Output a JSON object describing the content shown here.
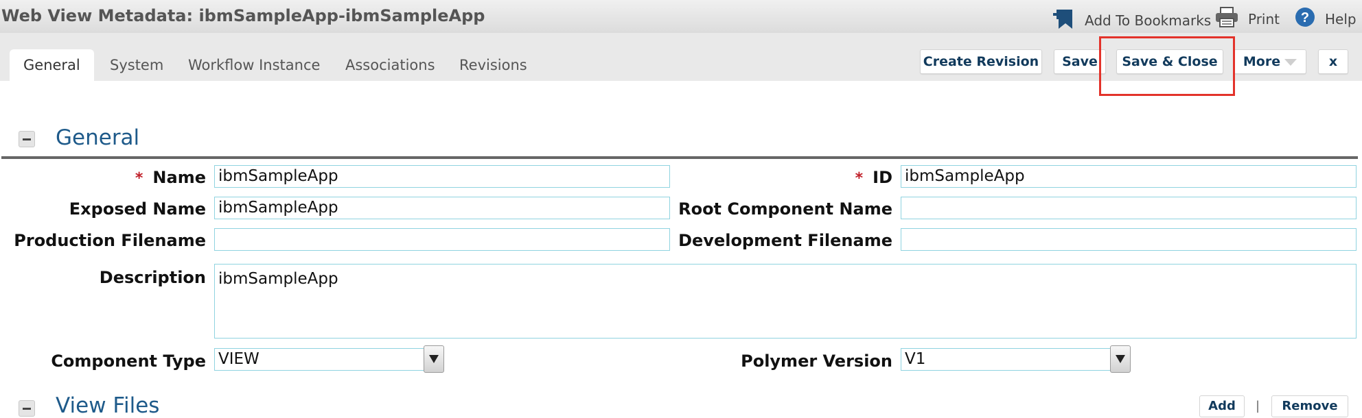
{
  "window": {
    "title": "Web View Metadata: ibmSampleApp-ibmSampleApp",
    "actions": {
      "bookmark": {
        "label": "Add To Bookmarks",
        "icon": "bookmark-add-icon"
      },
      "print": {
        "label": "Print",
        "icon": "printer-icon"
      },
      "help": {
        "label": "Help",
        "icon": "help-icon"
      }
    }
  },
  "tabs": [
    {
      "label": "General",
      "active": true
    },
    {
      "label": "System"
    },
    {
      "label": "Workflow Instance"
    },
    {
      "label": "Associations"
    },
    {
      "label": "Revisions"
    }
  ],
  "toolbar": {
    "create_revision": "Create Revision",
    "save": "Save",
    "save_close": "Save & Close",
    "more": "More",
    "close": "x"
  },
  "general_section": {
    "title": "General",
    "fields": {
      "name": {
        "label": "Name",
        "value": "ibmSampleApp",
        "required": true
      },
      "id": {
        "label": "ID",
        "value": "ibmSampleApp",
        "required": true
      },
      "exposed_name": {
        "label": "Exposed Name",
        "value": "ibmSampleApp"
      },
      "root_component_name": {
        "label": "Root Component Name",
        "value": ""
      },
      "production_filename": {
        "label": "Production Filename",
        "value": ""
      },
      "development_filename": {
        "label": "Development Filename",
        "value": ""
      },
      "description": {
        "label": "Description",
        "value": "ibmSampleApp"
      },
      "component_type": {
        "label": "Component Type",
        "value": "VIEW"
      },
      "polymer_version": {
        "label": "Polymer Version",
        "value": "V1"
      }
    },
    "required_marker": "*"
  },
  "view_files_section": {
    "title": "View Files",
    "add": "Add",
    "separator": "|",
    "remove": "Remove"
  },
  "colors": {
    "accent_title": "#1e5a8a",
    "button_text": "#113a5c",
    "highlight_box": "#e3322a",
    "field_border": "#8fd3e0",
    "required": "#c0202a"
  }
}
